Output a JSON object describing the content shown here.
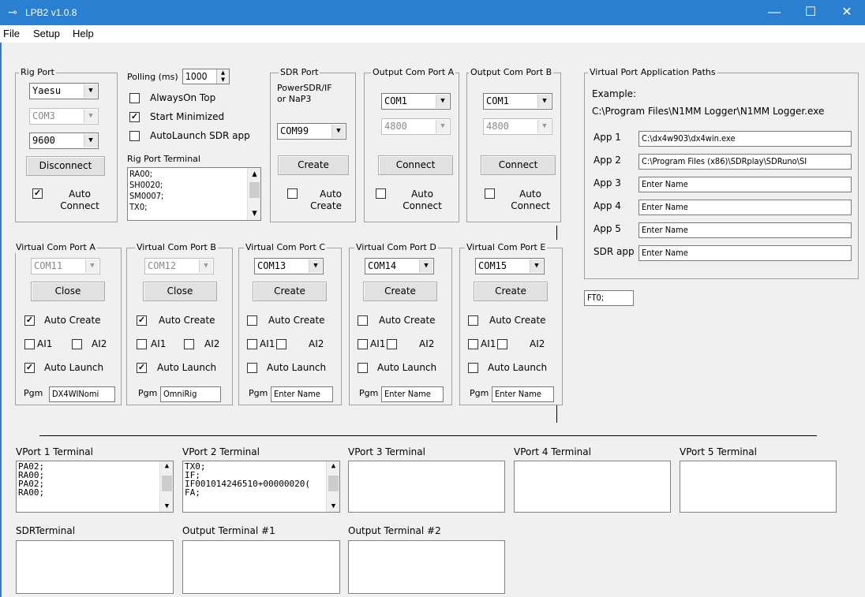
{
  "window": {
    "title": "LPB2 v1.0.8",
    "minimize": "—",
    "maximize": "☐",
    "close": "✕"
  },
  "menu": [
    "File",
    "Setup",
    "Help"
  ],
  "rig_port": {
    "title": "Rig Port",
    "radio": "Yaesu",
    "com": "COM3",
    "baud": "9600",
    "disconnect": "Disconnect",
    "auto_connect": "Auto Connect"
  },
  "polling": {
    "label": "Polling (ms)",
    "value": "1000",
    "always_on_top": "AlwaysOn Top",
    "start_minimized": "Start Minimized",
    "autolaunch_sdr": "AutoLaunch SDR app"
  },
  "rig_terminal": {
    "label": "Rig Port Terminal",
    "lines": "RA00;\nSH0020;\nSM0007;\nTX0;"
  },
  "sdr_port": {
    "title": "SDR Port",
    "desc": "PowerSDR/IF\nor NaP3",
    "com": "COM99",
    "create": "Create",
    "auto_create": "Auto Create"
  },
  "out_a": {
    "title": "Output Com Port A",
    "com": "COM1",
    "baud": "4800",
    "connect": "Connect",
    "auto_connect": "Auto Connect"
  },
  "out_b": {
    "title": "Output Com Port B",
    "com": "COM1",
    "baud": "4800",
    "connect": "Connect",
    "auto_connect": "Auto Connect"
  },
  "paths": {
    "title": "Virtual Port Application Paths",
    "example_label": "Example:",
    "example": "C:\\Program Files\\N1MM Logger\\N1MM Logger.exe",
    "apps": [
      {
        "label": "App 1",
        "value": "C:\\dx4w903\\dx4win.exe"
      },
      {
        "label": "App 2",
        "value": "C:\\Program Files (x86)\\SDRplay\\SDRuno\\SI"
      },
      {
        "label": "App 3",
        "value": "Enter Name"
      },
      {
        "label": "App 4",
        "value": "Enter Name"
      },
      {
        "label": "App 5",
        "value": "Enter Name"
      },
      {
        "label": "SDR app",
        "value": "Enter Name"
      }
    ]
  },
  "ft_box": "FT0;",
  "vports": [
    {
      "title": "Virtual Com Port A",
      "com": "COM11",
      "btn": "Close",
      "auto_create": "Auto Create",
      "ai1": "AI1",
      "ai2": "AI2",
      "auto_launch": "Auto Launch",
      "pgm_label": "Pgm",
      "pgm": "DX4WINomi"
    },
    {
      "title": "Virtual Com Port B",
      "com": "COM12",
      "btn": "Close",
      "auto_create": "Auto Create",
      "ai1": "AI1",
      "ai2": "AI2",
      "auto_launch": "Auto Launch",
      "pgm_label": "Pgm",
      "pgm": "OmniRig"
    },
    {
      "title": "Virtual Com Port C",
      "com": "COM13",
      "btn": "Create",
      "auto_create": "Auto Create",
      "ai1": "AI1",
      "ai2": "AI2",
      "auto_launch": "Auto Launch",
      "pgm_label": "Pgm",
      "pgm": "Enter Name"
    },
    {
      "title": "Virtual Com Port D",
      "com": "COM14",
      "btn": "Create",
      "auto_create": "Auto Create",
      "ai1": "AI1",
      "ai2": "AI2",
      "auto_launch": "Auto Launch",
      "pgm_label": "Pgm",
      "pgm": "Enter Name"
    },
    {
      "title": "Virtual Com Port E",
      "com": "COM15",
      "btn": "Create",
      "auto_create": "Auto Create",
      "ai1": "AI1",
      "ai2": "AI2",
      "auto_launch": "Auto Launch",
      "pgm_label": "Pgm",
      "pgm": "Enter Name"
    }
  ],
  "terminals": [
    {
      "label": "VPort 1 Terminal",
      "text": "PA02;\nRA00;\nPA02;\nRA00;"
    },
    {
      "label": "VPort 2 Terminal",
      "text": "TX0;\nIF;\nIF001014246510+00000020(\nFA;"
    },
    {
      "label": "VPort 3 Terminal",
      "text": ""
    },
    {
      "label": "VPort 4 Terminal",
      "text": ""
    },
    {
      "label": "VPort 5 Terminal",
      "text": ""
    },
    {
      "label": "SDRTerminal",
      "text": ""
    },
    {
      "label": "Output Terminal #1",
      "text": ""
    },
    {
      "label": "Output Terminal #2",
      "text": ""
    }
  ],
  "arrow_down": "▼",
  "arrow_up": "▲",
  "check": "✓"
}
